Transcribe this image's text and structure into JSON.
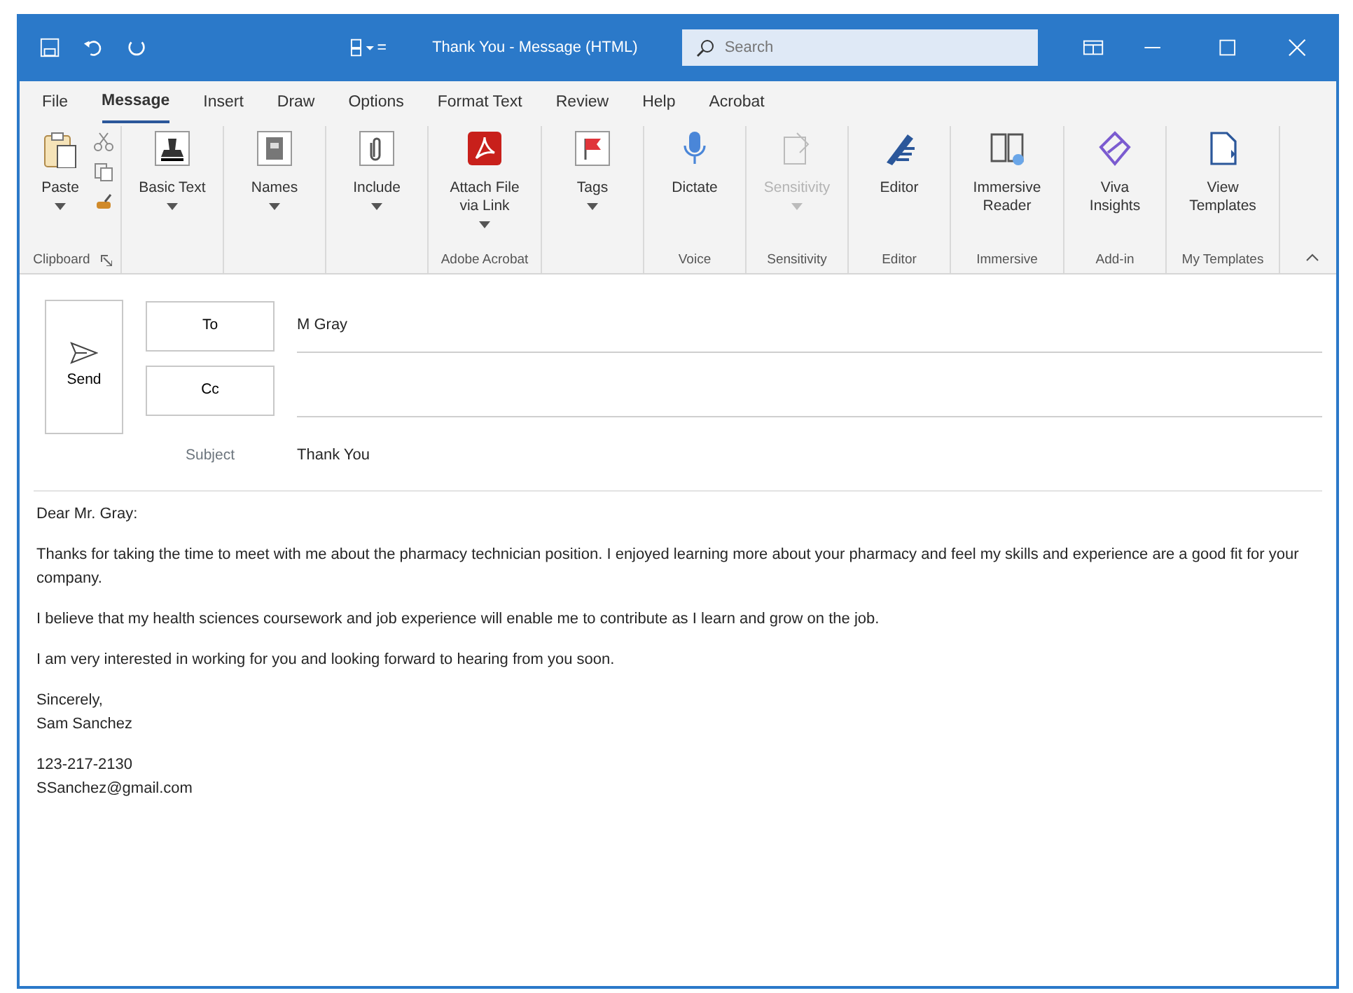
{
  "window": {
    "title": "Thank You - Message (HTML)",
    "search": {
      "placeholder": "Search"
    }
  },
  "tabs": [
    {
      "label": "File",
      "selected": false
    },
    {
      "label": "Message",
      "selected": true
    },
    {
      "label": "Insert",
      "selected": false
    },
    {
      "label": "Draw",
      "selected": false
    },
    {
      "label": "Options",
      "selected": false
    },
    {
      "label": "Format Text",
      "selected": false
    },
    {
      "label": "Review",
      "selected": false
    },
    {
      "label": "Help",
      "selected": false
    },
    {
      "label": "Acrobat",
      "selected": false
    }
  ],
  "ribbon_groups": [
    {
      "label": "Clipboard",
      "launcher": true,
      "buttons": [
        {
          "kind": "paste",
          "label": "Paste",
          "dropdown": true,
          "disabled": false
        }
      ]
    },
    {
      "buttons": [
        {
          "kind": "basic-text",
          "label": "Basic Text",
          "dropdown": true,
          "disabled": false
        }
      ]
    },
    {
      "buttons": [
        {
          "kind": "names",
          "label": "Names",
          "dropdown": true,
          "disabled": false
        }
      ]
    },
    {
      "buttons": [
        {
          "kind": "include",
          "label": "Include",
          "dropdown": true,
          "disabled": false
        }
      ]
    },
    {
      "label": "Adobe Acrobat",
      "buttons": [
        {
          "kind": "pdf",
          "label": "Attach File via Link",
          "dropdown": true,
          "disabled": false
        }
      ]
    },
    {
      "buttons": [
        {
          "kind": "flag",
          "label": "Tags",
          "dropdown": true,
          "disabled": false
        }
      ]
    },
    {
      "label": "Voice",
      "buttons": [
        {
          "kind": "mic",
          "label": "Dictate",
          "dropdown": false,
          "disabled": false
        }
      ]
    },
    {
      "label": "Sensitivity",
      "buttons": [
        {
          "kind": "sensitivity",
          "label": "Sensitivity",
          "dropdown": true,
          "disabled": true
        }
      ]
    },
    {
      "label": "Editor",
      "buttons": [
        {
          "kind": "pen",
          "label": "Editor",
          "dropdown": false,
          "disabled": false
        }
      ]
    },
    {
      "label": "Immersive",
      "buttons": [
        {
          "kind": "book",
          "label": "Immersive Reader",
          "dropdown": false,
          "disabled": false
        }
      ]
    },
    {
      "label": "Add-in",
      "buttons": [
        {
          "kind": "viva",
          "label": "Viva Insights",
          "dropdown": false,
          "disabled": false
        }
      ]
    },
    {
      "label": "My Templates",
      "buttons": [
        {
          "kind": "template",
          "label": "View Templates",
          "dropdown": false,
          "disabled": false
        }
      ]
    }
  ],
  "header": {
    "send": "Send",
    "to": {
      "label": "To",
      "value": "M Gray"
    },
    "cc": {
      "label": "Cc"
    },
    "subject": {
      "label": "Subject",
      "value": "Thank You"
    }
  },
  "body": [
    {
      "lines": [
        "Dear Mr. Gray:"
      ]
    },
    {
      "lines": [
        "Thanks for taking the time to meet with me about the pharmacy technician position. I enjoyed learning more about your pharmacy and feel my skills and experience are a good fit for your company."
      ]
    },
    {
      "lines": [
        "I believe that my health sciences coursework and job experience will enable me to contribute as I learn and grow on the job."
      ]
    },
    {
      "lines": [
        "I am very interested in working for you and looking forward to hearing from you soon."
      ]
    },
    {
      "lines": [
        "Sincerely,",
        "Sam Sanchez"
      ]
    },
    {
      "lines": [
        "123-217-2130",
        "SSanchez@gmail.com"
      ]
    }
  ]
}
